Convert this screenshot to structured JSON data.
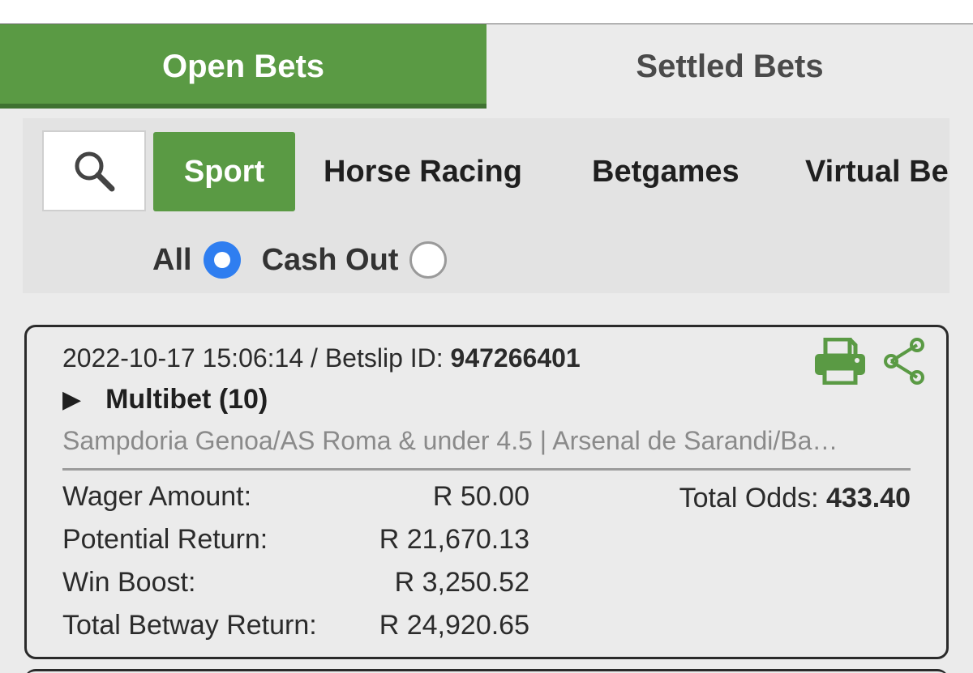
{
  "tabs": [
    {
      "label": "Open Bets",
      "active": true
    },
    {
      "label": "Settled Bets",
      "active": false
    }
  ],
  "filters": {
    "search_icon": "search-icon",
    "categories": [
      "Sport",
      "Horse Racing",
      "Betgames",
      "Virtual Be"
    ],
    "selected_category": "Sport",
    "radio": {
      "all_label": "All",
      "cashout_label": "Cash Out",
      "selected": "All"
    }
  },
  "bet": {
    "timestamp": "2022-10-17 15:06:14",
    "separator": " / Betslip ID: ",
    "betslip_id": "947266401",
    "expand_icon": "▶",
    "type": "Multibet (10)",
    "selections": "Sampdoria Genoa/AS Roma & under 4.5 | Arsenal de Sarandi/Ba…",
    "rows": [
      {
        "label": "Wager Amount:",
        "value": "R 50.00"
      },
      {
        "label": "Potential Return:",
        "value": "R 21,670.13"
      },
      {
        "label": "Win Boost:",
        "value": "R 3,250.52"
      },
      {
        "label": "Total Betway Return:",
        "value": "R 24,920.65"
      }
    ],
    "total_odds_label": "Total Odds: ",
    "total_odds_value": "433.40",
    "icons": [
      "printer-icon",
      "share-icon"
    ]
  },
  "colors": {
    "brand_green": "#5a9a44",
    "radio_blue": "#2f7ef0"
  }
}
